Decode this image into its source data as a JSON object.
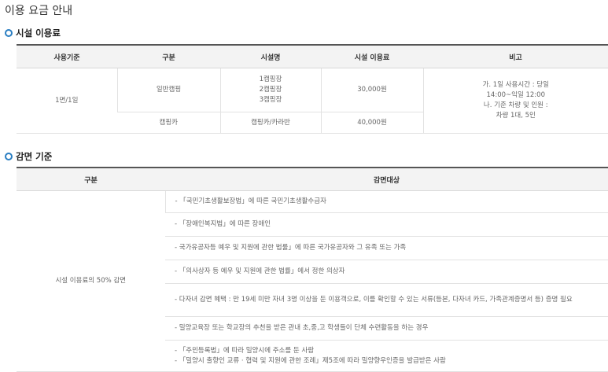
{
  "page_title": "이용 요금 안내",
  "fee_section": {
    "title": "시설 이용료",
    "headers": [
      "사용기준",
      "구분",
      "시설명",
      "시설 이용료",
      "비고"
    ],
    "usage_basis": "1면/1일",
    "rows": [
      {
        "category": "일반캠핑",
        "facilities": "1캠핑장\n2캠핑장\n3캠핑장",
        "fee": "30,000원"
      },
      {
        "category": "캠핑카",
        "facilities": "캠핑카/카라반",
        "fee": "40,000원"
      }
    ],
    "remark": "가. 1일 사용시간 : 당일\n14:00~익일 12:00\n나. 기준 차량 및 인원 :\n차량 1대, 5인"
  },
  "discount_section": {
    "title": "감면 기준",
    "headers": [
      "구분",
      "감면대상"
    ],
    "category": "시설 이용료의 50% 감면",
    "items": [
      "- 「국민기초생활보장법」에 따른 국민기초생활수급자",
      "- 「장애인복지법」에 따른 장애인",
      "- 국가유공자등 예우 및 지원에 관한 법률」에 따른 국가유공자와 그 유족 또는 가족",
      "- 「의사상자 등 예우 및 지원에 관한 법률」에서 정한 의상자",
      "- 다자녀 감면 혜택 : 만 19세 미만 자녀 3명 이상을 둔 이용객으로, 이를 확인할 수 있는 서류(등본, 다자녀 카드, 가족관계증명서 등) 증명 필요",
      "- 밀양교육장 또는 학교장의 추천을 받은 관내 초,중,고 학생들이 단체 수련활동을 하는 경우",
      "- 「주민등록법」에 따라 밀양시에 주소를 둔 사람\n- 「밀양시 출향인 교류 · 협력 및 지원에 관한 조례」제5조에 따라 밀양향우인증을 발급받은 사람"
    ]
  }
}
